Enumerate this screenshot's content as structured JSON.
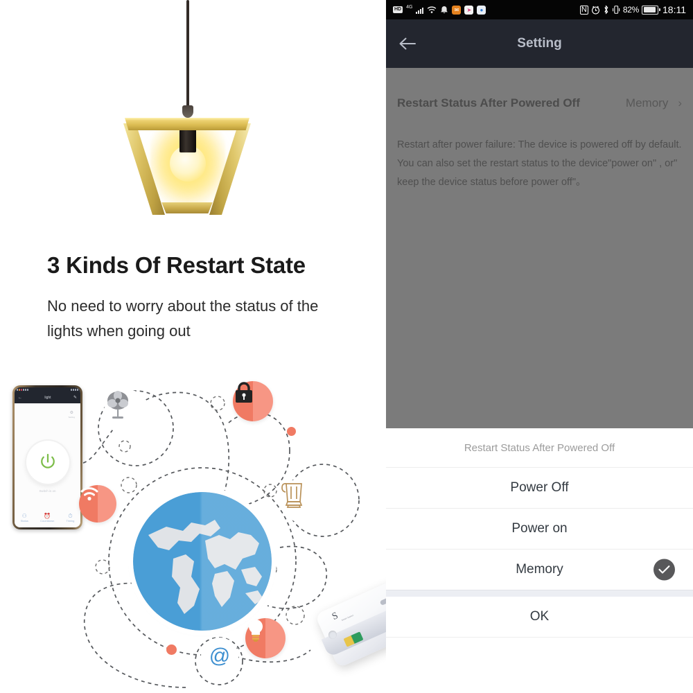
{
  "left": {
    "headline": "3 Kinds Of Restart State",
    "subcopy": "No need to worry about the status of the lights when going out",
    "phone_mockup": {
      "nav_title": "light",
      "gear_label": "Setting",
      "state_label": "Switch is on",
      "tabs": [
        {
          "label": "Status",
          "icon": "toggle-icon"
        },
        {
          "label": "Countdown",
          "icon": "clock-icon"
        },
        {
          "label": "Timing",
          "icon": "timer-icon"
        }
      ]
    },
    "illustration": {
      "nodes": [
        {
          "name": "fan-icon",
          "style": "white"
        },
        {
          "name": "lock-icon",
          "style": "red"
        },
        {
          "name": "wifi-icon",
          "style": "red"
        },
        {
          "name": "kettle-icon",
          "style": "white"
        },
        {
          "name": "email-icon",
          "style": "white"
        },
        {
          "name": "bulb-icon",
          "style": "red"
        }
      ],
      "globe_label": "world-globe"
    },
    "device_label": {
      "brand": "S",
      "caption": "Smart Switch"
    }
  },
  "right": {
    "statusbar": {
      "hd": "HD",
      "network": "4G",
      "battery_percent": "82%",
      "time": "18:11",
      "icons": [
        "hd-icon",
        "4g-icon",
        "signal-icon",
        "wifi-icon",
        "bell-icon",
        "mail-icon",
        "app-pink-icon",
        "app-blue-icon",
        "nfc-icon",
        "alarm-icon",
        "bluetooth-icon",
        "vibrate-icon",
        "battery-icon"
      ]
    },
    "navbar": {
      "back_icon": "back-arrow-icon",
      "title": "Setting"
    },
    "setting_row": {
      "label": "Restart Status After Powered Off",
      "value": "Memory",
      "chevron": "chevron-right-icon"
    },
    "description": "Restart after power failure: The device is powered off by default. You can also set the restart status to the device\"power on\" , or\" keep the device status before power off\"。",
    "action_sheet": {
      "title": "Restart Status After Powered Off",
      "options": [
        {
          "label": "Power Off",
          "selected": false
        },
        {
          "label": "Power on",
          "selected": false
        },
        {
          "label": "Memory",
          "selected": true
        }
      ],
      "confirm_label": "OK",
      "check_icon": "check-circle-icon"
    }
  },
  "colors": {
    "statusbar_bg": "#050505",
    "navbar_bg": "#23262f",
    "content_overlay": "#7b7b7b",
    "sheet_bg": "#ffffff",
    "accent_red": "#f07a63",
    "globe_blue": "#4a9ed6",
    "gold": "#dcc263",
    "check_circle": "#58585a"
  }
}
